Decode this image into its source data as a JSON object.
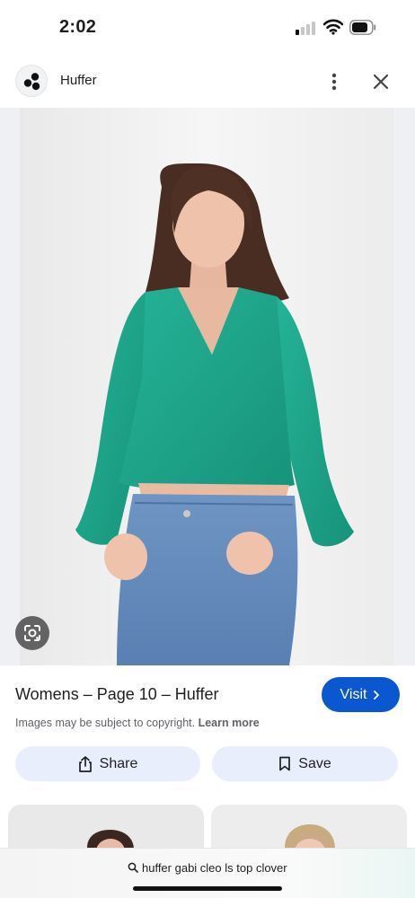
{
  "status_bar": {
    "time": "2:02"
  },
  "header": {
    "site_name": "Huffer",
    "more_icon": "vertical-dots-icon",
    "close_icon": "close-icon"
  },
  "image": {
    "lens_icon": "lens-icon"
  },
  "result": {
    "title": "Womens – Page 10 – Huffer",
    "visit_label": "Visit",
    "copyright_text": "Images may be subject to copyright.",
    "learn_more_label": "Learn more",
    "share_label": "Share",
    "save_label": "Save"
  },
  "search": {
    "query": "huffer gabi cleo ls top clover"
  },
  "colors": {
    "accent": "#0b57d0",
    "chip_bg": "#e8eefb",
    "top_color": "#1fa88c"
  }
}
